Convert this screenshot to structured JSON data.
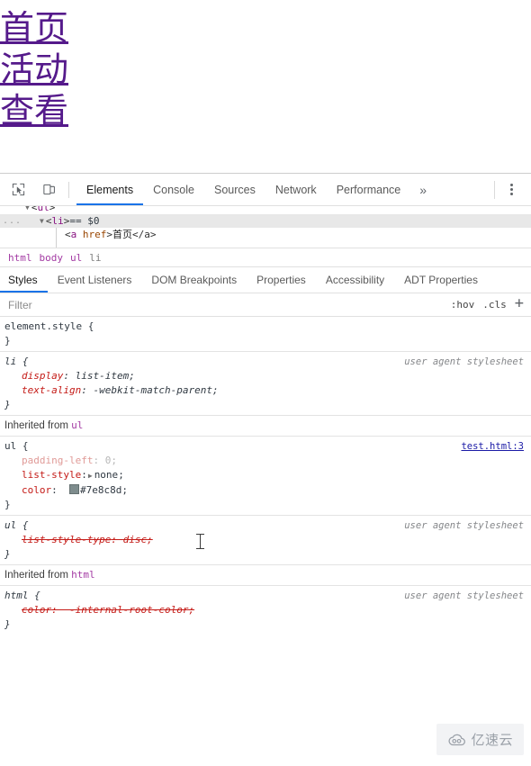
{
  "page": {
    "links": [
      {
        "text": "首页"
      },
      {
        "text": "活动"
      },
      {
        "text": "查看"
      }
    ]
  },
  "devtools": {
    "toolbar": {
      "inspect_icon": "inspect-cursor-icon",
      "device_toolbar_icon": "device-toolbar-icon",
      "tabs": [
        {
          "label": "Elements",
          "active": true
        },
        {
          "label": "Console",
          "active": false
        },
        {
          "label": "Sources",
          "active": false
        },
        {
          "label": "Network",
          "active": false
        },
        {
          "label": "Performance",
          "active": false
        }
      ],
      "overflow_label": "»",
      "more_options_icon": "kebab-menu-icon"
    },
    "dom_tree": {
      "rows": [
        {
          "indent": 28,
          "twisty": "▼",
          "open_punc": "<",
          "tag": "ul",
          "close_punc": ">",
          "selected": false
        },
        {
          "indent": 44,
          "twisty": "▼",
          "open_punc": "<",
          "tag": "li",
          "close_punc": ">",
          "suffix": " == $0",
          "selected": true,
          "ellipsis": "..."
        },
        {
          "indent": 72,
          "open_punc": "<",
          "tag": "a",
          "attr": "href",
          "close_punc": ">",
          "text": "首页",
          "end_tag": "</a>",
          "selected": false
        }
      ]
    },
    "breadcrumb": [
      "html",
      "body",
      "ul",
      "li"
    ],
    "sidebar_tabs": [
      {
        "label": "Styles",
        "active": true
      },
      {
        "label": "Event Listeners",
        "active": false
      },
      {
        "label": "DOM Breakpoints",
        "active": false
      },
      {
        "label": "Properties",
        "active": false
      },
      {
        "label": "Accessibility",
        "active": false
      },
      {
        "label": "ADT Properties",
        "active": false
      }
    ],
    "filter": {
      "placeholder": "Filter",
      "value": "",
      "hov_label": ":hov",
      "cls_label": ".cls",
      "new_rule_label": "+"
    },
    "styles": {
      "rules": [
        {
          "id": "element-style",
          "selector": "element.style",
          "origin": "",
          "origin_is_link": false,
          "user_agent": false,
          "declarations": []
        },
        {
          "id": "li-ua",
          "selector": "li",
          "origin": "user agent stylesheet",
          "origin_is_link": false,
          "user_agent": true,
          "declarations": [
            {
              "name": "display",
              "value": "list-item",
              "state": "normal"
            },
            {
              "name": "text-align",
              "value": "-webkit-match-parent",
              "state": "normal"
            }
          ]
        },
        {
          "id": "inherited-ul",
          "inherited_from": "Inherited from",
          "inherited_element": "ul"
        },
        {
          "id": "ul-author",
          "selector": "ul",
          "origin": "test.html:3",
          "origin_is_link": true,
          "user_agent": false,
          "declarations": [
            {
              "name": "padding-left",
              "value": "0",
              "state": "dim"
            },
            {
              "name": "list-style",
              "value": "none",
              "state": "normal",
              "expandable": true
            },
            {
              "name": "color",
              "value": "#7e8c8d",
              "state": "normal",
              "swatch": "#7e8c8d"
            }
          ]
        },
        {
          "id": "ul-ua",
          "selector": "ul",
          "origin": "user agent stylesheet",
          "origin_is_link": false,
          "user_agent": true,
          "declarations": [
            {
              "name": "list-style-type",
              "value": "disc",
              "state": "struck"
            }
          ]
        },
        {
          "id": "inherited-html",
          "inherited_from": "Inherited from",
          "inherited_element": "html"
        },
        {
          "id": "html-ua",
          "selector": "html",
          "origin": "user agent stylesheet",
          "origin_is_link": false,
          "user_agent": true,
          "declarations": [
            {
              "name": "color",
              "value": "-internal-root-color",
              "state": "struck"
            }
          ]
        }
      ]
    }
  },
  "watermark": {
    "text": "亿速云",
    "icon": "cloud-icon"
  },
  "colors": {
    "visited_link": "#551a8b",
    "accent_blue": "#1a73e8",
    "ul_color_value": "#7e8c8d",
    "selected_row": "#e8e8e8",
    "property_red": "#c41a16",
    "tag_purple": "#881280"
  }
}
